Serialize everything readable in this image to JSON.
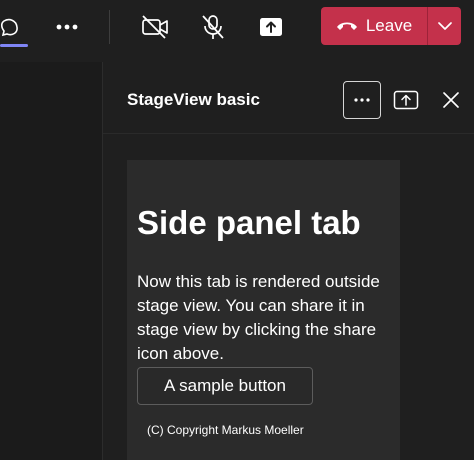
{
  "meeting_bar": {
    "leave_label": "Leave",
    "icons": [
      "chat-icon-partial",
      "more-icon",
      "camera-off-icon",
      "mic-off-icon",
      "share-icon",
      "hangup-icon",
      "chevron-down-icon"
    ],
    "leave_color": "#c4314b",
    "accent_color": "#7f85f5"
  },
  "side_panel": {
    "title": "StageView basic",
    "icons": [
      "more-icon",
      "share-to-stage-icon",
      "close-icon"
    ]
  },
  "tab": {
    "heading": "Side panel tab",
    "body": "Now this tab is rendered outside stage view. You can share it in stage view by clicking the share icon above.",
    "button_label": "A sample button",
    "copyright": "(C) Copyright Markus Moeller"
  }
}
